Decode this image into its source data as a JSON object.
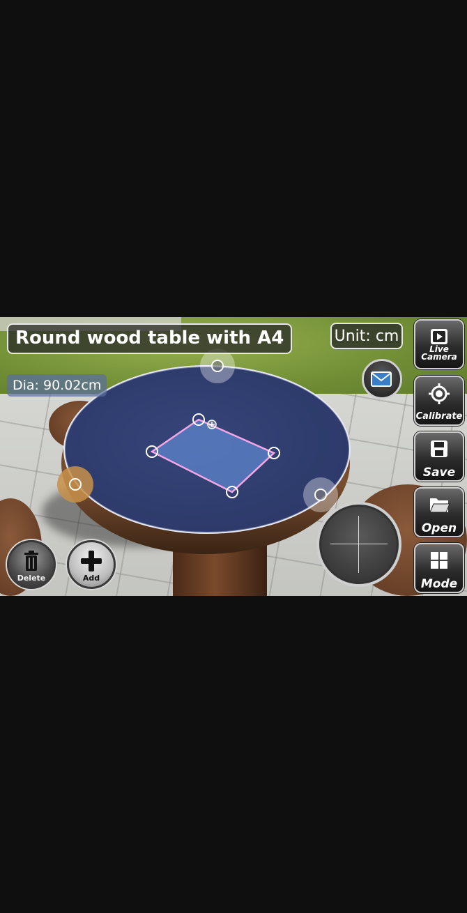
{
  "header": {
    "title": "Round wood table with A4",
    "unit_label": "Unit: cm",
    "measurement": "Dia: 90.02cm"
  },
  "sidebar": {
    "live_camera_line1": "Live",
    "live_camera_line2": "Camera",
    "calibrate": "Calibrate",
    "save": "Save",
    "open": "Open",
    "mode": "Mode"
  },
  "bottom": {
    "delete": "Delete",
    "add": "Add"
  },
  "icons": [
    "live-camera-icon",
    "crosshair-icon",
    "floppy-disk-icon",
    "folder-icon",
    "grid-icon",
    "trash-icon",
    "plus-icon",
    "mail-icon"
  ],
  "colors": {
    "ellipse_fill": "#2f3d6e",
    "rect_fill": "#4f74b8",
    "rect_stroke": "#f0a0e0",
    "accent_handle": "#c8904a"
  }
}
